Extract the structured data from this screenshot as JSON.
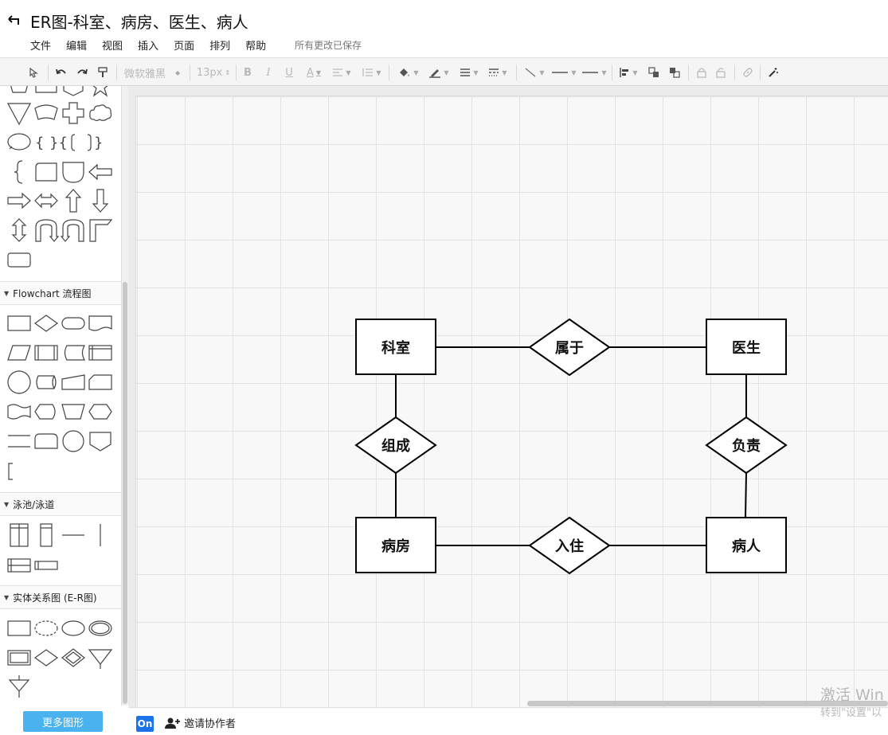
{
  "header": {
    "title": "ER图-科室、病房、医生、病人",
    "menu": [
      "文件",
      "编辑",
      "视图",
      "插入",
      "页面",
      "排列",
      "帮助"
    ],
    "save_status": "所有更改已保存"
  },
  "toolbar": {
    "font_family": "微软雅黑",
    "font_size": "13px",
    "bold": "B",
    "italic": "I",
    "underline": "U",
    "font_color": "A"
  },
  "sidebar": {
    "sections": [
      {
        "label": "Flowchart 流程图"
      },
      {
        "label": "泳池/泳道"
      },
      {
        "label": "实体关系图 (E-R图)"
      }
    ],
    "more_shapes": "更多图形"
  },
  "diagram": {
    "entities": [
      {
        "id": "dept",
        "label": "科室"
      },
      {
        "id": "doctor",
        "label": "医生"
      },
      {
        "id": "ward",
        "label": "病房"
      },
      {
        "id": "patient",
        "label": "病人"
      }
    ],
    "relationships": [
      {
        "id": "belongs",
        "label": "属于",
        "from": "dept",
        "to": "doctor"
      },
      {
        "id": "compose",
        "label": "组成",
        "from": "dept",
        "to": "ward"
      },
      {
        "id": "responsible",
        "label": "负责",
        "from": "doctor",
        "to": "patient"
      },
      {
        "id": "stay",
        "label": "入住",
        "from": "ward",
        "to": "patient"
      }
    ]
  },
  "bottom": {
    "on_badge": "On",
    "invite": "邀请协作者"
  },
  "watermark": {
    "line1": "激活 Win",
    "line2": "转到\"设置\"以"
  }
}
